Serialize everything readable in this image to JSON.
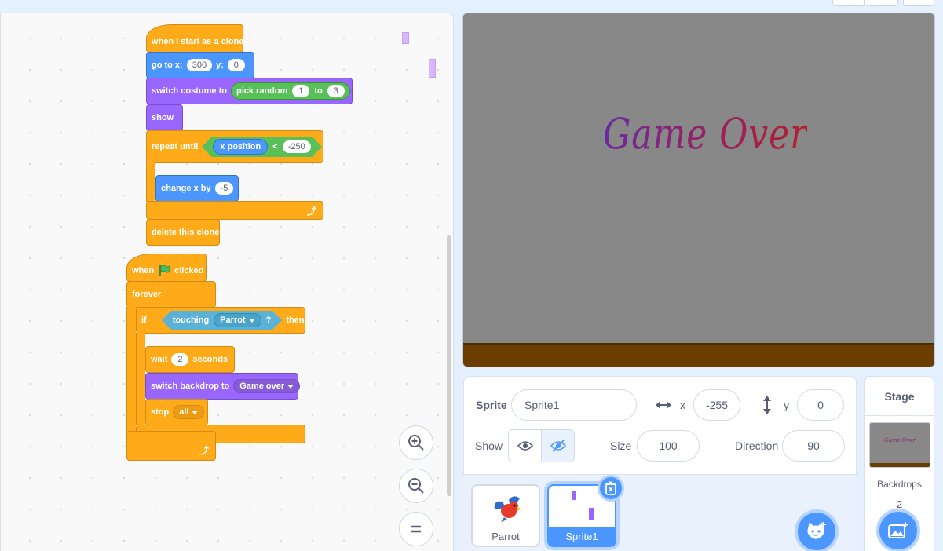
{
  "workspace": {
    "script1": {
      "hat_label": "when I start as a clone",
      "goto_label": "go to x:",
      "goto_x": "300",
      "goto_y_label": "y:",
      "goto_y": "0",
      "costume_label": "switch costume to",
      "pick_random": "pick random",
      "rand_from": "1",
      "rand_to_label": "to",
      "rand_to": "3",
      "show_label": "show",
      "repeat_label": "repeat until",
      "xpos_label": "x position",
      "lt_label": "<",
      "lt_value": "-250",
      "change_label": "change x by",
      "change_value": "-5",
      "delete_label": "delete this clone"
    },
    "script2": {
      "hat_when": "when",
      "hat_clicked": "clicked",
      "forever_label": "forever",
      "if_label": "if",
      "touching_label": "touching",
      "touching_target": "Parrot",
      "question": "?",
      "then_label": "then",
      "wait_label": "wait",
      "wait_value": "2",
      "seconds_label": "seconds",
      "backdrop_label": "switch backdrop to",
      "backdrop_value": "Game over",
      "stop_label": "stop",
      "stop_value": "all"
    }
  },
  "stage": {
    "text": "Game Over"
  },
  "sprite_info": {
    "sprite_label": "Sprite",
    "sprite_name": "Sprite1",
    "x_label": "x",
    "x_value": "-255",
    "y_label": "y",
    "y_value": "0",
    "show_label": "Show",
    "size_label": "Size",
    "size_value": "100",
    "direction_label": "Direction",
    "direction_value": "90"
  },
  "sprites": [
    {
      "name": "Parrot"
    },
    {
      "name": "Sprite1"
    }
  ],
  "stage_panel": {
    "title": "Stage",
    "thumb_text": "Game Over",
    "backdrops_label": "Backdrops",
    "backdrops_count": "2"
  },
  "colors": {
    "motion": "#4c97ff",
    "looks": "#9966ff",
    "control": "#ffab19",
    "operators": "#59c059",
    "sensing": "#5cb1d6"
  }
}
